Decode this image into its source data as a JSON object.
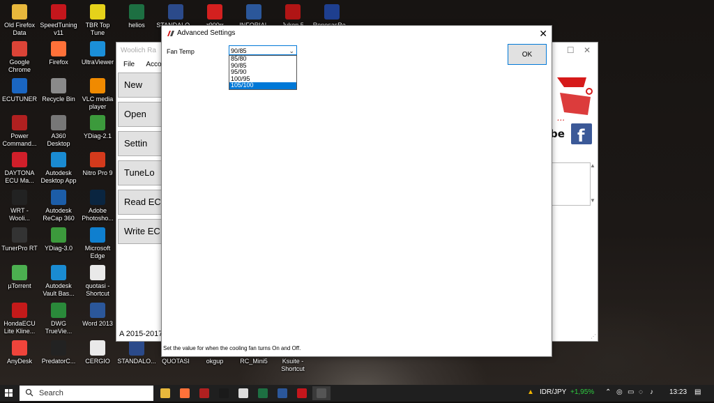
{
  "desktop": {
    "icons": [
      {
        "label": "Old Firefox Data",
        "icon": "folder-icon",
        "color": "#e8b83c"
      },
      {
        "label": "SpeedTuning v11",
        "icon": "speedtuning-icon",
        "color": "#c4161c"
      },
      {
        "label": "TBR Top Tune",
        "icon": "tbr-icon",
        "color": "#e6d21a"
      },
      {
        "label": "helios",
        "icon": "excel-file-icon",
        "color": "#1d6f42"
      },
      {
        "label": "STANDALO...",
        "icon": "flag-file-icon",
        "color": "#2b4a8a"
      },
      {
        "label": "z900rr",
        "icon": "pdf-file-icon",
        "color": "#d3201f"
      },
      {
        "label": "INFORIAL",
        "icon": "word-file-icon",
        "color": "#2b579a"
      },
      {
        "label": "Juken 5",
        "icon": "juken-icon",
        "color": "#b01515"
      },
      {
        "label": "RenesasRe...",
        "icon": "renesas-icon",
        "color": "#1e3f8f"
      },
      {
        "label": "Google Chrome",
        "icon": "chrome-icon",
        "color": "#db4437"
      },
      {
        "label": "Firefox",
        "icon": "firefox-icon",
        "color": "#ff7139"
      },
      {
        "label": "UltraViewer",
        "icon": "ultraviewer-icon",
        "color": "#1b8fd8"
      },
      {
        "label": "ECUTUNER",
        "icon": "ecutuner-icon",
        "color": "#1a66c2"
      },
      {
        "label": "Recycle Bin",
        "icon": "recycle-bin-icon",
        "color": "#8a8a8a"
      },
      {
        "label": "VLC media player",
        "icon": "vlc-icon",
        "color": "#f08a00"
      },
      {
        "label": "Power Command...",
        "icon": "power-command-icon",
        "color": "#b02020"
      },
      {
        "label": "A360 Desktop",
        "icon": "a360-icon",
        "color": "#777777"
      },
      {
        "label": "YDiag-2.1",
        "icon": "ydiag-icon",
        "color": "#3c9a3c"
      },
      {
        "label": "DAYTONA ECU Ma...",
        "icon": "daytona-icon",
        "color": "#d01f2a"
      },
      {
        "label": "Autodesk Desktop App",
        "icon": "autodesk-icon",
        "color": "#1a8bd2"
      },
      {
        "label": "Nitro Pro 9",
        "icon": "nitro-icon",
        "color": "#d43a1c"
      },
      {
        "label": "WRT - Wooli...",
        "icon": "wrt-icon",
        "color": "#222222"
      },
      {
        "label": "Autodesk ReCap 360",
        "icon": "recap-icon",
        "color": "#1c5da8"
      },
      {
        "label": "Adobe Photosho...",
        "icon": "photoshop-icon",
        "color": "#0a2540"
      },
      {
        "label": "TunerPro RT",
        "icon": "tunerpro-icon",
        "color": "#333333"
      },
      {
        "label": "YDiag-3.0",
        "icon": "ydiag-icon",
        "color": "#3c9a3c"
      },
      {
        "label": "Microsoft Edge",
        "icon": "edge-icon",
        "color": "#0f7fcf"
      },
      {
        "label": "µTorrent",
        "icon": "utorrent-icon",
        "color": "#4caf50"
      },
      {
        "label": "Autodesk Vault Bas...",
        "icon": "vault-icon",
        "color": "#1a8bd2"
      },
      {
        "label": "quotasi - Shortcut",
        "icon": "shortcut-file-icon",
        "color": "#e9e9e9"
      },
      {
        "label": "HondaECU Lite Kline...",
        "icon": "hondaecu-icon",
        "color": "#c41a1a"
      },
      {
        "label": "DWG TrueVie...",
        "icon": "dwg-icon",
        "color": "#2a8a3a"
      },
      {
        "label": "Word 2013",
        "icon": "word-icon",
        "color": "#2b579a"
      },
      {
        "label": "AnyDesk",
        "icon": "anydesk-icon",
        "color": "#ef443b"
      },
      {
        "label": "PredatorC...",
        "icon": "predator-icon",
        "color": "#222222"
      },
      {
        "label": "CERGIO",
        "icon": "file-icon",
        "color": "#e9e9e9"
      },
      {
        "label": "STANDALO...",
        "icon": "flag-file-icon",
        "color": "#2b4a8a"
      },
      {
        "label": "QUOTASI",
        "icon": "file-icon",
        "color": "#e9e9e9"
      },
      {
        "label": "okgup",
        "icon": "file-icon",
        "color": "#e9e9e9"
      },
      {
        "label": "RC_Mini5",
        "icon": "rc-mini-icon",
        "color": "#555555"
      },
      {
        "label": "Ksuite - Shortcut",
        "icon": "ksuite-icon",
        "color": "#f2f2f2"
      }
    ]
  },
  "woolich": {
    "title": "Woolich Ra",
    "menu": [
      "File",
      "Accou"
    ],
    "buttons": [
      "New",
      "Open",
      "Settin",
      "TuneLo",
      "Read EC",
      "Write EC"
    ],
    "footer": "A 2015-2017"
  },
  "dialog": {
    "title": "Advanced Settings",
    "fan_label": "Fan Temp",
    "selected": "90/85",
    "options": [
      "85/80",
      "90/85",
      "95/90",
      "100/95",
      "105/100"
    ],
    "highlighted": "105/100",
    "ok_label": "OK",
    "status_text": "Set the value for when the cooling fan turns On and Off."
  },
  "taskbar": {
    "search_placeholder": "Search",
    "apps": [
      "file-explorer-icon",
      "firefox-icon",
      "tuner-app-icon",
      "red-app-icon",
      "k-app-icon",
      "excel-icon",
      "word-icon",
      "shield-app-icon",
      "woolich-icon"
    ],
    "ticker": "IDR/JPY",
    "ticker_change": "+1,95%",
    "time": "13:23",
    "accent": "#0078d7",
    "positive": "#2ecc40"
  }
}
